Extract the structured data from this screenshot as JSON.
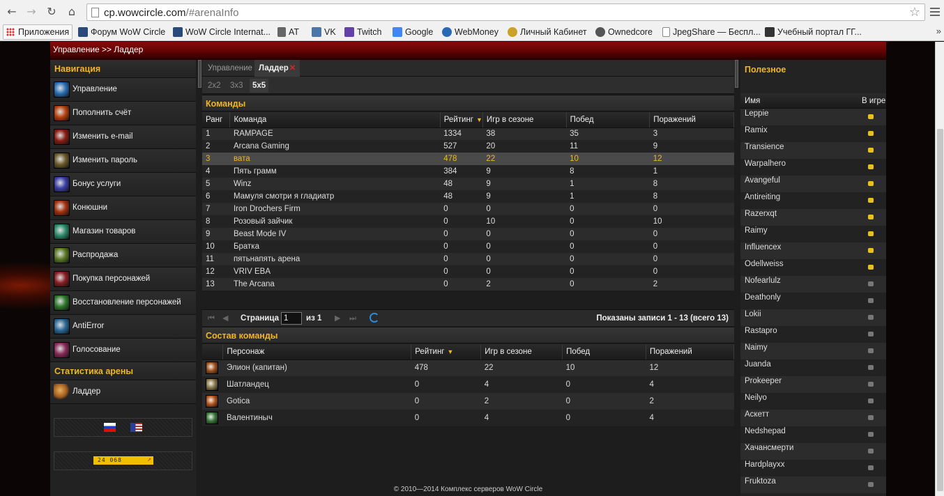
{
  "browser": {
    "url_host": "cp.wowcircle.com",
    "url_path": "/#arenaInfo",
    "bookmarks": [
      {
        "label": "Приложения",
        "icon": "apps-grid-icon"
      },
      {
        "label": "Форум WoW Circle",
        "icon": "wowcircle-icon"
      },
      {
        "label": "WoW Circle Internat...",
        "icon": "wowcircle-icon"
      },
      {
        "label": "AT",
        "icon": "at-icon"
      },
      {
        "label": "VK",
        "icon": "vk-icon"
      },
      {
        "label": "Twitch",
        "icon": "twitch-icon"
      },
      {
        "label": "Google",
        "icon": "google-icon"
      },
      {
        "label": "WebMoney",
        "icon": "webmoney-icon"
      },
      {
        "label": "Личный Кабинет",
        "icon": "wow-icon"
      },
      {
        "label": "Ownedcore",
        "icon": "ownedcore-icon"
      },
      {
        "label": "JpegShare — Беспл...",
        "icon": "page-icon"
      },
      {
        "label": "Учебный портал ГГ...",
        "icon": "school-icon"
      }
    ]
  },
  "header": {
    "breadcrumb": "Управление >> Ладдер"
  },
  "leftnav": {
    "title": "Навигация",
    "items": [
      {
        "label": "Управление",
        "color": "#2a6fb5"
      },
      {
        "label": "Пополнить счёт",
        "color": "#b8420f"
      },
      {
        "label": "Изменить e-mail",
        "color": "#8a1d12"
      },
      {
        "label": "Изменить пароль",
        "color": "#6b5a2a"
      },
      {
        "label": "Бонус услуги",
        "color": "#3b3fa8"
      },
      {
        "label": "Конюшни",
        "color": "#a5310f"
      },
      {
        "label": "Магазин товаров",
        "color": "#2b8a6a"
      },
      {
        "label": "Распродажа",
        "color": "#5a7a22"
      },
      {
        "label": "Покупка персонажей",
        "color": "#8a1d22"
      },
      {
        "label": "Восстановление персонажей",
        "color": "#2d7a2d"
      },
      {
        "label": "AntiError",
        "color": "#2a6a9a"
      },
      {
        "label": "Голосование",
        "color": "#8a2a5a"
      }
    ],
    "arena_title": "Статистика арены",
    "arena_items": [
      {
        "label": "Ладдер",
        "color": "#a05a1a"
      }
    ],
    "badge_text": "24 068"
  },
  "center": {
    "tabs": [
      {
        "label": "Управление"
      },
      {
        "label": "Ладдер"
      }
    ],
    "close_glyph": "✕",
    "brackets": [
      "2x2",
      "3x3",
      "5x5"
    ],
    "teams_title": "Команды",
    "teams_columns": [
      "Ранг",
      "Команда",
      "Рейтинг",
      "Игр в сезоне",
      "Побед",
      "Поражений"
    ],
    "teams": [
      [
        "1",
        "RAMPAGE",
        "1334",
        "38",
        "35",
        "3"
      ],
      [
        "2",
        "Arcana Gaming",
        "527",
        "20",
        "11",
        "9"
      ],
      [
        "3",
        "вата",
        "478",
        "22",
        "10",
        "12"
      ],
      [
        "4",
        "Пять грамм",
        "384",
        "9",
        "8",
        "1"
      ],
      [
        "5",
        "Winz",
        "48",
        "9",
        "1",
        "8"
      ],
      [
        "6",
        "Мамуля смотри я гладиатр",
        "48",
        "9",
        "1",
        "8"
      ],
      [
        "7",
        "Iron Drochers Firm",
        "0",
        "0",
        "0",
        "0"
      ],
      [
        "8",
        "Розовый зайчик",
        "0",
        "10",
        "0",
        "10"
      ],
      [
        "9",
        "Beast Mode IV",
        "0",
        "0",
        "0",
        "0"
      ],
      [
        "10",
        "Братка",
        "0",
        "0",
        "0",
        "0"
      ],
      [
        "11",
        "пятьнапять арена",
        "0",
        "0",
        "0",
        "0"
      ],
      [
        "12",
        "VRIV EBA",
        "0",
        "0",
        "0",
        "0"
      ],
      [
        "13",
        "The Arcana",
        "0",
        "2",
        "0",
        "2"
      ]
    ],
    "pager": {
      "page_label": "Страница",
      "page_value": "1",
      "of_label": "из 1",
      "summary": "Показаны записи 1 - 13 (всего 13)"
    },
    "members_title": "Состав команды",
    "members_columns": [
      "Персонаж",
      "Рейтинг",
      "Игр в сезоне",
      "Побед",
      "Поражений"
    ],
    "members": [
      {
        "name": "Элион (капитан)",
        "rating": "478",
        "games": "22",
        "wins": "10",
        "losses": "12",
        "color": "#a0521a"
      },
      {
        "name": "Шатландец",
        "rating": "0",
        "games": "4",
        "wins": "0",
        "losses": "4",
        "color": "#8a7a4a"
      },
      {
        "name": "Gotica",
        "rating": "0",
        "games": "2",
        "wins": "0",
        "losses": "2",
        "color": "#b8541a"
      },
      {
        "name": "Валентиныч",
        "rating": "0",
        "games": "4",
        "wins": "0",
        "losses": "4",
        "color": "#3a7a3a"
      }
    ]
  },
  "right": {
    "title": "Полезное",
    "col_name": "Имя",
    "col_ingame": "В игре",
    "players": [
      {
        "name": "Leppie",
        "online": true
      },
      {
        "name": "Ramix",
        "online": true
      },
      {
        "name": "Transience",
        "online": true
      },
      {
        "name": "Warpalhero",
        "online": true
      },
      {
        "name": "Avangeful",
        "online": true
      },
      {
        "name": "Antireiting",
        "online": true
      },
      {
        "name": "Razerxqt",
        "online": true
      },
      {
        "name": "Raimy",
        "online": true
      },
      {
        "name": "Influencex",
        "online": true
      },
      {
        "name": "Odellweiss",
        "online": true
      },
      {
        "name": "Nofearlulz",
        "online": false
      },
      {
        "name": "Deathonly",
        "online": false
      },
      {
        "name": "Lokii",
        "online": false
      },
      {
        "name": "Rastapro",
        "online": false
      },
      {
        "name": "Naimy",
        "online": false
      },
      {
        "name": "Juanda",
        "online": false
      },
      {
        "name": "Prokeeper",
        "online": false
      },
      {
        "name": "Neilyo",
        "online": false
      },
      {
        "name": "Аскетт",
        "online": false
      },
      {
        "name": "Nedshepad",
        "online": false
      },
      {
        "name": "Хачансмерти",
        "online": false
      },
      {
        "name": "Hardplayxx",
        "online": false
      },
      {
        "name": "Fruktoza",
        "online": false
      }
    ]
  },
  "footer": {
    "text": "© 2010—2014 Комплекс серверов WoW Circle"
  }
}
